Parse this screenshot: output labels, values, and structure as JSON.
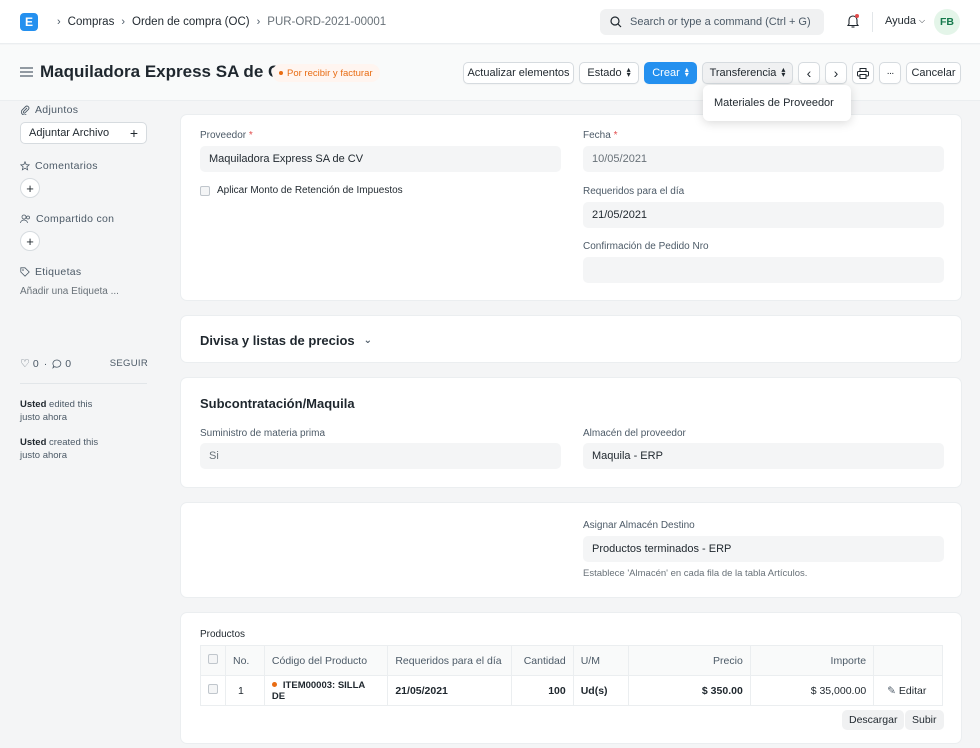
{
  "navbar": {
    "logo_letter": "E",
    "breadcrumbs": [
      "Compras",
      "Orden de compra (OC)",
      "PUR-ORD-2021-00001"
    ],
    "search_placeholder": "Search or type a command (Ctrl + G)",
    "help_label": "Ayuda",
    "avatar_initials": "FB"
  },
  "header": {
    "title": "Maquiladora Express SA de CV",
    "status": "Por recibir y facturar",
    "buttons": {
      "update_items": "Actualizar elementos",
      "status": "Estado",
      "create": "Crear",
      "transfer": "Transferencia",
      "cancel": "Cancelar"
    },
    "dropdown_item": "Materiales de Proveedor"
  },
  "sidebar": {
    "attachments_label": "Adjuntos",
    "attach_button": "Adjuntar Archivo",
    "comments_label": "Comentarios",
    "shared_label": "Compartido con",
    "tags_label": "Etiquetas",
    "add_tag": "Añadir una Etiqueta ...",
    "likes": "0",
    "comments_count": "0",
    "follow": "SEGUIR",
    "activity": [
      {
        "user": "Usted",
        "text": "edited this",
        "time": "justo ahora"
      },
      {
        "user": "Usted",
        "text": "created this",
        "time": "justo ahora"
      }
    ]
  },
  "form": {
    "supplier_label": "Proveedor",
    "supplier_value": "Maquiladora Express SA de CV",
    "withholding_label": "Aplicar Monto de Retención de Impuestos",
    "date_label": "Fecha",
    "date_value": "10/05/2021",
    "required_by_label": "Requeridos para el día",
    "required_by_value": "21/05/2021",
    "confirmation_label": "Confirmación de Pedido Nro",
    "confirmation_value": ""
  },
  "currency_section": {
    "title": "Divisa y listas de precios"
  },
  "subcontract": {
    "title": "Subcontratación/Maquila",
    "raw_material_label": "Suministro de materia prima",
    "raw_material_value": "Si",
    "supplier_warehouse_label": "Almacén del proveedor",
    "supplier_warehouse_value": "Maquila - ERP"
  },
  "target": {
    "label": "Asignar Almacén Destino",
    "value": "Productos terminados - ERP",
    "hint": "Establece 'Almacén' en cada fila de la tabla Artículos."
  },
  "products": {
    "label": "Productos",
    "columns": [
      "No.",
      "Código del Producto",
      "Requeridos para el día",
      "Cantidad",
      "U/M",
      "Precio",
      "Importe"
    ],
    "rows": [
      {
        "no": "1",
        "code": "ITEM00003: SILLA DE",
        "required": "21/05/2021",
        "qty": "100",
        "uom": "Ud(s)",
        "rate": "$ 350.00",
        "amount": "$ 35,000.00",
        "edit": "Editar"
      }
    ],
    "download": "Descargar",
    "upload": "Subir"
  }
}
